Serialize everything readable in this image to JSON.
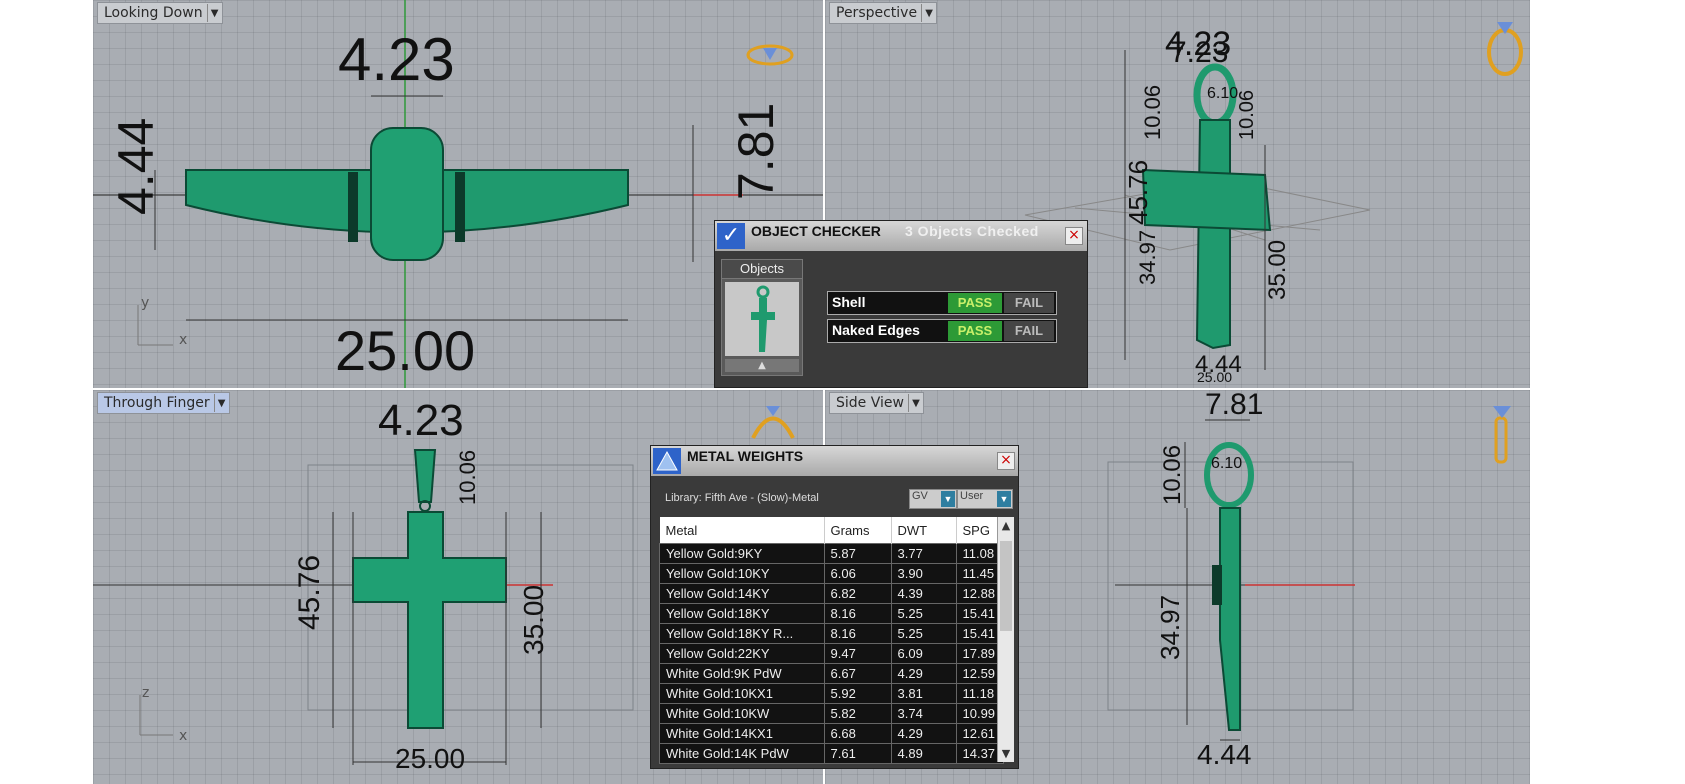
{
  "viewports": {
    "top_left": {
      "label": "Looking Down",
      "dims": {
        "top": "4.23",
        "left": "4.44",
        "right": "7.81",
        "bottom": "25.00"
      },
      "axes": {
        "v": "y",
        "h": "x"
      }
    },
    "top_right": {
      "label": "Perspective",
      "dims": {
        "a": "4.23",
        "b": "7.23",
        "c": "10.06",
        "d": "6.10",
        "e": "10.06",
        "f": "45.76",
        "g": "34.97",
        "h": "35.00",
        "i": "4.44",
        "j": "25.00"
      }
    },
    "bottom_left": {
      "label": "Through Finger",
      "dims": {
        "top": "4.23",
        "bail": "10.06",
        "left": "45.76",
        "right": "35.00",
        "bottom": "25.00"
      },
      "axes": {
        "v": "z",
        "h": "x"
      }
    },
    "bottom_right": {
      "label": "Side View",
      "dims": {
        "top": "7.81",
        "bail": "10.06",
        "inner": "6.10",
        "left": "34.97",
        "bottom": "4.44"
      }
    }
  },
  "object_checker": {
    "title": "OBJECT CHECKER",
    "count": "3  Objects Checked",
    "objects_label": "Objects",
    "checks": [
      {
        "name": "Shell",
        "pass": "PASS",
        "fail": "FAIL"
      },
      {
        "name": "Naked Edges",
        "pass": "PASS",
        "fail": "FAIL"
      }
    ]
  },
  "metal_weights": {
    "title": "METAL WEIGHTS",
    "library": "Library: Fifth Ave - (Slow)-Metal",
    "select1": "GV",
    "select2": "User",
    "columns": [
      "Metal",
      "Grams",
      "DWT",
      "SPG"
    ],
    "rows": [
      [
        "Yellow Gold:9KY",
        "5.87",
        "3.77",
        "11.08"
      ],
      [
        "Yellow Gold:10KY",
        "6.06",
        "3.90",
        "11.45"
      ],
      [
        "Yellow Gold:14KY",
        "6.82",
        "4.39",
        "12.88"
      ],
      [
        "Yellow Gold:18KY",
        "8.16",
        "5.25",
        "15.41"
      ],
      [
        "Yellow Gold:18KY R...",
        "8.16",
        "5.25",
        "15.41"
      ],
      [
        "Yellow Gold:22KY",
        "9.47",
        "6.09",
        "17.89"
      ],
      [
        "White Gold:9K PdW",
        "6.67",
        "4.29",
        "12.59"
      ],
      [
        "White Gold:10KX1",
        "5.92",
        "3.81",
        "11.18"
      ],
      [
        "White Gold:10KW",
        "5.82",
        "3.74",
        "10.99"
      ],
      [
        "White Gold:14KX1",
        "6.68",
        "4.29",
        "12.61"
      ],
      [
        "White Gold:14K PdW",
        "7.61",
        "4.89",
        "14.37"
      ]
    ]
  },
  "colors": {
    "viewport_bg": "#a9adb3",
    "model": "#1f9a6e",
    "pass": "#2d9a36",
    "icon": "#e0a020"
  }
}
